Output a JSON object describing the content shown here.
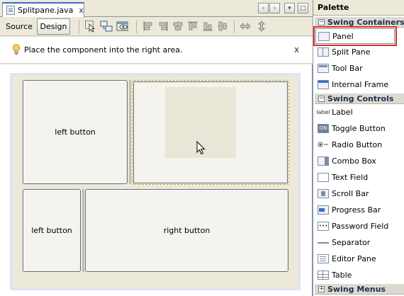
{
  "editor": {
    "tab_title": "Splitpane.java",
    "tab_close": "x",
    "source_label": "Source",
    "design_label": "Design",
    "nav_buttons": [
      "‹",
      "›",
      "▾",
      "□"
    ]
  },
  "hint": {
    "text": "Place the component into the right area.",
    "close": "x"
  },
  "form": {
    "top_left_button": "left button",
    "bottom_left_button": "left button",
    "bottom_right_button": "right button"
  },
  "palette": {
    "title": "Palette",
    "categories": [
      {
        "label": "Swing Containers",
        "toggle": "−",
        "items": [
          {
            "label": "Panel",
            "icon": "panel-icon"
          },
          {
            "label": "Split Pane",
            "icon": "split-pane-icon"
          },
          {
            "label": "Tool Bar",
            "icon": "tool-bar-icon"
          },
          {
            "label": "Internal Frame",
            "icon": "internal-frame-icon"
          }
        ]
      },
      {
        "label": "Swing Controls",
        "toggle": "−",
        "items": [
          {
            "label": "Label",
            "icon": "label-icon",
            "icon_text": "label"
          },
          {
            "label": "Toggle Button",
            "icon": "toggle-button-icon",
            "icon_text": "ON"
          },
          {
            "label": "Radio Button",
            "icon": "radio-button-icon"
          },
          {
            "label": "Combo Box",
            "icon": "combo-box-icon"
          },
          {
            "label": "Text Field",
            "icon": "text-field-icon"
          },
          {
            "label": "Scroll Bar",
            "icon": "scroll-bar-icon"
          },
          {
            "label": "Progress Bar",
            "icon": "progress-bar-icon"
          },
          {
            "label": "Password Field",
            "icon": "password-field-icon",
            "icon_text": "•••"
          },
          {
            "label": "Separator",
            "icon": "separator-icon"
          },
          {
            "label": "Editor Pane",
            "icon": "editor-pane-icon"
          },
          {
            "label": "Table",
            "icon": "table-icon"
          }
        ]
      },
      {
        "label": "Swing Menus",
        "toggle": "+",
        "items": []
      }
    ]
  },
  "colors": {
    "selection_outline": "#d83030",
    "drop_border": "#c19a2a",
    "tab_accent": "#3b6fc7"
  }
}
